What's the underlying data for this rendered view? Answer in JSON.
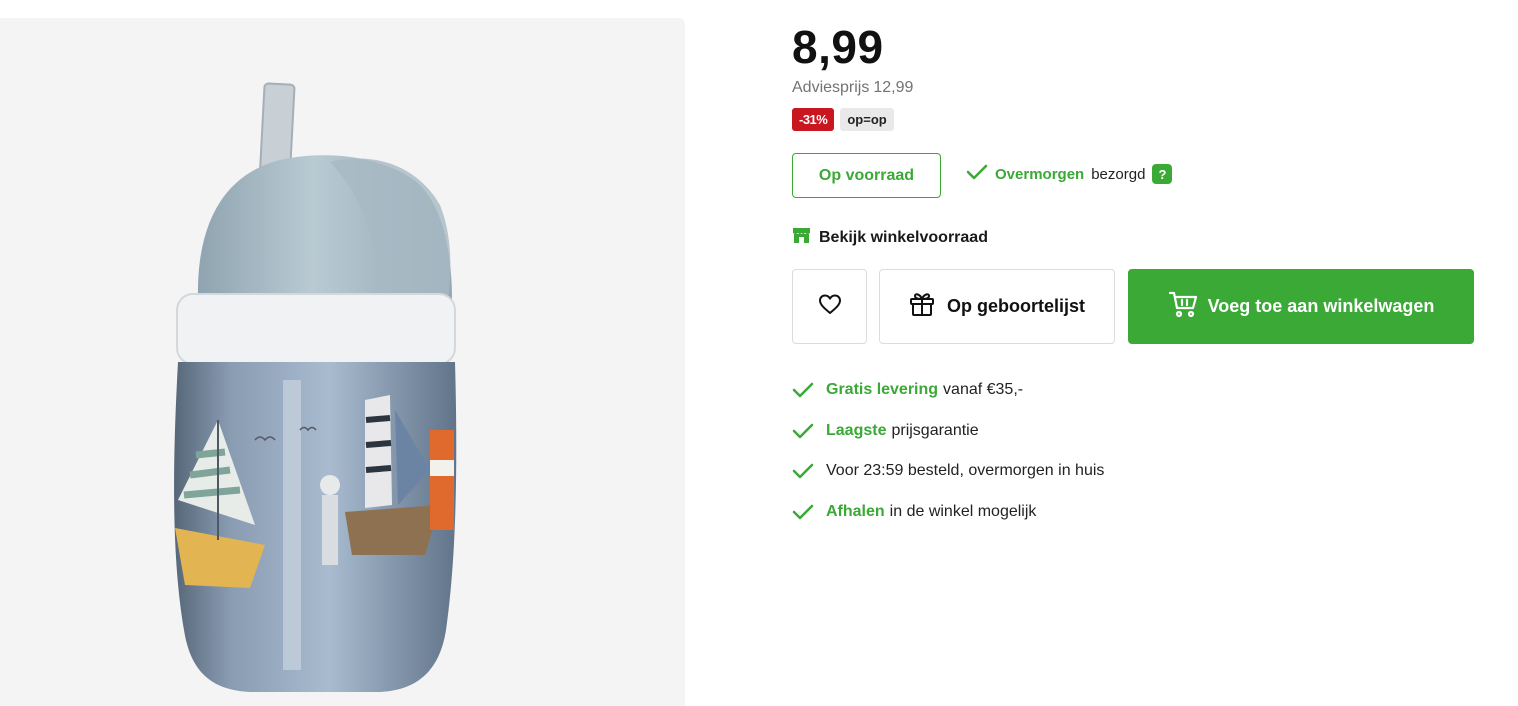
{
  "product": {
    "price": "8,99",
    "advies_label": "Adviesprijs",
    "advies_price": "12,99",
    "badges": [
      {
        "text": "-31%",
        "color": "#c8171e"
      },
      {
        "text": "op=op",
        "color": "#e9e9e9"
      }
    ]
  },
  "availability": {
    "stock_label": "Op voorraad",
    "delivery_day": "Overmorgen",
    "delivery_suffix": "bezorgd",
    "help_symbol": "?"
  },
  "store": {
    "label": "Bekijk winkelvoorraad",
    "icon": "store-icon"
  },
  "actions": {
    "favorite_icon": "heart-icon",
    "birthlist_label": "Op geboortelijst",
    "birthlist_icon": "gift-icon",
    "cart_label": "Voeg toe aan winkelwagen",
    "cart_icon": "cart-icon"
  },
  "usps": [
    {
      "highlight": "Gratis levering",
      "text": "vanaf €35,-"
    },
    {
      "highlight": "Laagste",
      "text": "prijsgarantie"
    },
    {
      "highlight": "",
      "text": "Voor 23:59 besteld, overmorgen in huis"
    },
    {
      "highlight": "Afhalen",
      "text": "in de winkel mogelijk"
    }
  ],
  "colors": {
    "accent_green": "#3aa935",
    "discount_red": "#c8171e",
    "gallery_bg": "#f4f4f4"
  }
}
